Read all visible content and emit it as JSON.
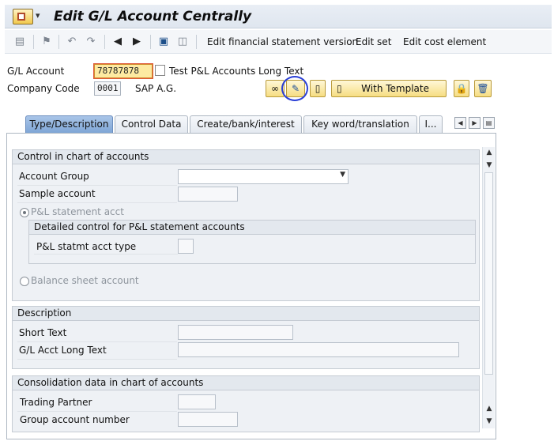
{
  "title": "Edit G/L Account Centrally",
  "toolbar": {
    "edit_fs_version": "Edit financial statement version",
    "edit_set": "Edit set",
    "edit_cost_element": "Edit cost element"
  },
  "header": {
    "gl_account_label": "G/L Account",
    "gl_account_value": "78787878",
    "gl_account_desc": "Test P&L Accounts Long Text",
    "company_code_label": "Company Code",
    "company_code_value": "0001",
    "company_name": "SAP A.G.",
    "with_template_label": "With Template"
  },
  "tabs": [
    {
      "label": "Type/Description",
      "active": true
    },
    {
      "label": "Control Data",
      "active": false
    },
    {
      "label": "Create/bank/interest",
      "active": false
    },
    {
      "label": "Key word/translation",
      "active": false
    },
    {
      "label": "I...",
      "active": false
    }
  ],
  "control": {
    "title": "Control in chart of accounts",
    "account_group_label": "Account Group",
    "sample_account_label": "Sample account",
    "pl_statement_label": "P&L statement acct",
    "pl_statement_selected": true,
    "detailed_title": "Detailed control for P&L statement accounts",
    "pl_type_label": "P&L statmt acct type",
    "balance_sheet_label": "Balance sheet account",
    "balance_sheet_selected": false
  },
  "description": {
    "title": "Description",
    "short_text_label": "Short Text",
    "long_text_label": "G/L Acct Long Text"
  },
  "consolidation": {
    "title": "Consolidation data in chart of accounts",
    "trading_partner_label": "Trading Partner",
    "group_account_label": "Group account number"
  },
  "colors": {
    "active_tab": "#7fa6d6",
    "highlight_field": "#fdeaa1",
    "annotation_circle": "#2a3fd6"
  }
}
